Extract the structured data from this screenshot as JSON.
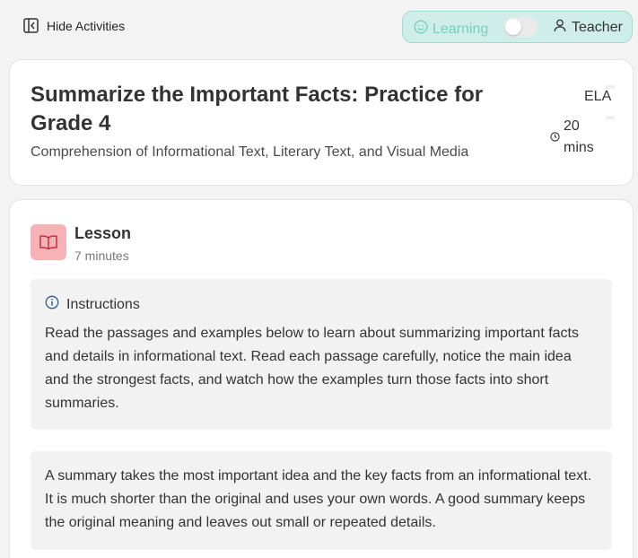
{
  "topbar": {
    "hide_activities_label": "Hide Activities",
    "mode_learning_label": "Learning",
    "mode_teacher_label": "Teacher"
  },
  "header": {
    "title": "Summarize the Important Facts: Practice for Grade 4",
    "subtitle": "Comprehension of Informational Text, Literary Text, and Visual Media",
    "subject": "ELA",
    "duration": "20 mins"
  },
  "lesson": {
    "title": "Lesson",
    "time": "7 minutes",
    "instructions_heading": "Instructions",
    "instructions_text": "Read the passages and examples below to learn about summarizing important facts and details in informational text. Read each passage carefully, notice the main idea and the strongest facts, and watch how the examples turn those facts into short summaries.",
    "summary_text": "A summary takes the most important idea and the key facts from an informational text. It is much shorter than the original and uses your own words. A good summary keeps the original meaning and leaves out small or repeated details."
  },
  "icons": {
    "hide_activities": "sidebar-collapse-icon",
    "learning": "smile-icon",
    "teacher": "user-icon",
    "duration": "clock-icon",
    "lesson": "book-open-icon",
    "instructions": "info-icon"
  },
  "colors": {
    "accent_teal": "#78cfc2",
    "toggle_bg": "#cfeee9",
    "lesson_icon_bg": "#f7b2b6",
    "lesson_icon_fg": "#c0303c",
    "info_blue": "#2f5d8a"
  }
}
